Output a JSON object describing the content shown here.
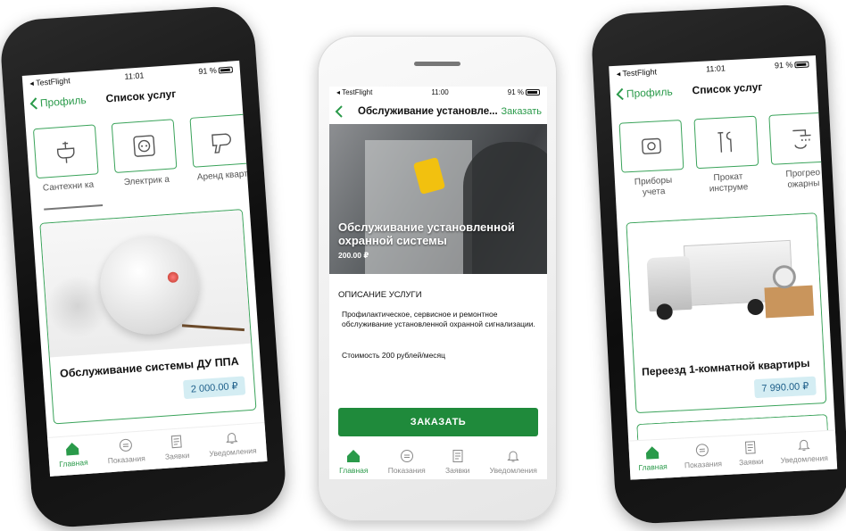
{
  "colors": {
    "accent": "#2a9a4a",
    "price_bg": "#d4edf3",
    "order_btn": "#1f8a3b"
  },
  "left": {
    "status": {
      "carrier": "◂ TestFlight",
      "time": "11:01",
      "battery": "91 %"
    },
    "nav": {
      "back": "Профиль",
      "title": "Список услуг"
    },
    "categories": [
      {
        "label": "Сантехни ка",
        "icon": "sink-icon"
      },
      {
        "label": "Электрик а",
        "icon": "socket-icon"
      },
      {
        "label": "Аренд кварти",
        "icon": "hairdryer-icon"
      }
    ],
    "card": {
      "name": "Обслуживание системы ДУ ППА",
      "price": "2 000.00 ₽"
    },
    "tabs": [
      "Главная",
      "Показания",
      "Заявки",
      "Уведомления"
    ]
  },
  "center": {
    "status": {
      "carrier": "◂ TestFlight",
      "time": "11:00",
      "battery": "91 %"
    },
    "nav": {
      "title": "Обслуживание установле...",
      "action": "Заказать"
    },
    "hero": {
      "title": "Обслуживание установленной охранной системы",
      "price": "200.00 ₽"
    },
    "description_header": "ОПИСАНИЕ УСЛУГИ",
    "description": "Профилактическое, сервисное и ремонтное обслуживание установленной охранной сигнализации.",
    "cost": "Стоимость 200 рублей/месяц",
    "order_button": "ЗАКАЗАТЬ",
    "tabs": [
      "Главная",
      "Показания",
      "Заявки",
      "Уведомления"
    ]
  },
  "right": {
    "status": {
      "carrier": "◂ TestFlight",
      "time": "11:01",
      "battery": "91 %"
    },
    "nav": {
      "back": "Профиль",
      "title": "Список услуг"
    },
    "categories": [
      {
        "label": "Приборы учета",
        "icon": "meter-icon"
      },
      {
        "label": "Прокат инструме",
        "icon": "tools-icon"
      },
      {
        "label": "Прогрео ожарны",
        "icon": "shower-icon"
      }
    ],
    "card": {
      "name": "Переезд 1-комнатной квартиры",
      "price": "7 990.00 ₽"
    },
    "tabs": [
      "Главная",
      "Показания",
      "Заявки",
      "Уведомления"
    ]
  }
}
